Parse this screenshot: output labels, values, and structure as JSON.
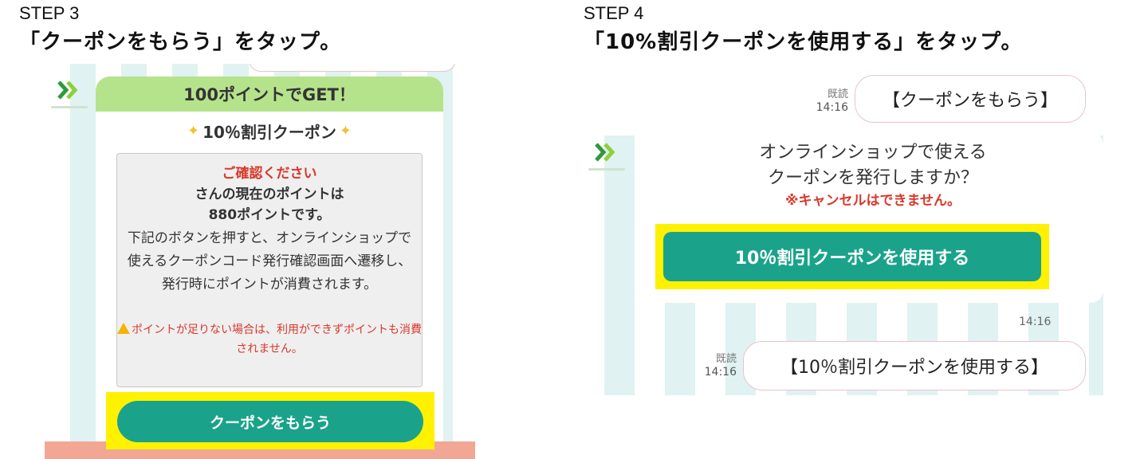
{
  "step3": {
    "label": "STEP 3",
    "title": "「クーポンをもらう」をタップ。",
    "card": {
      "header": "100ポイントでGET！",
      "subtitle": "10％割引クーポン",
      "notice_title": "ご確認ください",
      "notice_line1": "さんの現在のポイントは",
      "notice_line2": "880ポイントです。",
      "notice_body": "下記のボタンを押すと、オンラインショップで使えるクーポンコード発行確認画面へ遷移し、発行時にポイントが消費されます。",
      "warning": "ポイントが足りない場合は、利用ができずポイントも消費されません。"
    },
    "button_label": "クーポンをもらう"
  },
  "step4": {
    "label": "STEP 4",
    "title": "「10%割引クーポンを使用する」をタップ。",
    "first_message": {
      "read_label": "既読",
      "time": "14:16",
      "text": "【クーポンをもらう】"
    },
    "confirm": {
      "line1": "オンラインショップで使える",
      "line2": "クーポンを発行しますか？",
      "warning": "※キャンセルはできません。",
      "button_label": "10％割引クーポンを使用する",
      "time": "14:16"
    },
    "second_message": {
      "read_label": "既読",
      "time": "14:16",
      "text": "【10％割引クーポンを使用する】"
    }
  },
  "icons": {
    "brand_logo": "double-chevron-right-icon",
    "warning": "warning-icon",
    "sparkle": "sparkle-icon"
  },
  "colors": {
    "accent_green": "#1aa38a",
    "header_green": "#b5e38c",
    "highlight": "#fff100",
    "warning_red": "#d9382b"
  }
}
